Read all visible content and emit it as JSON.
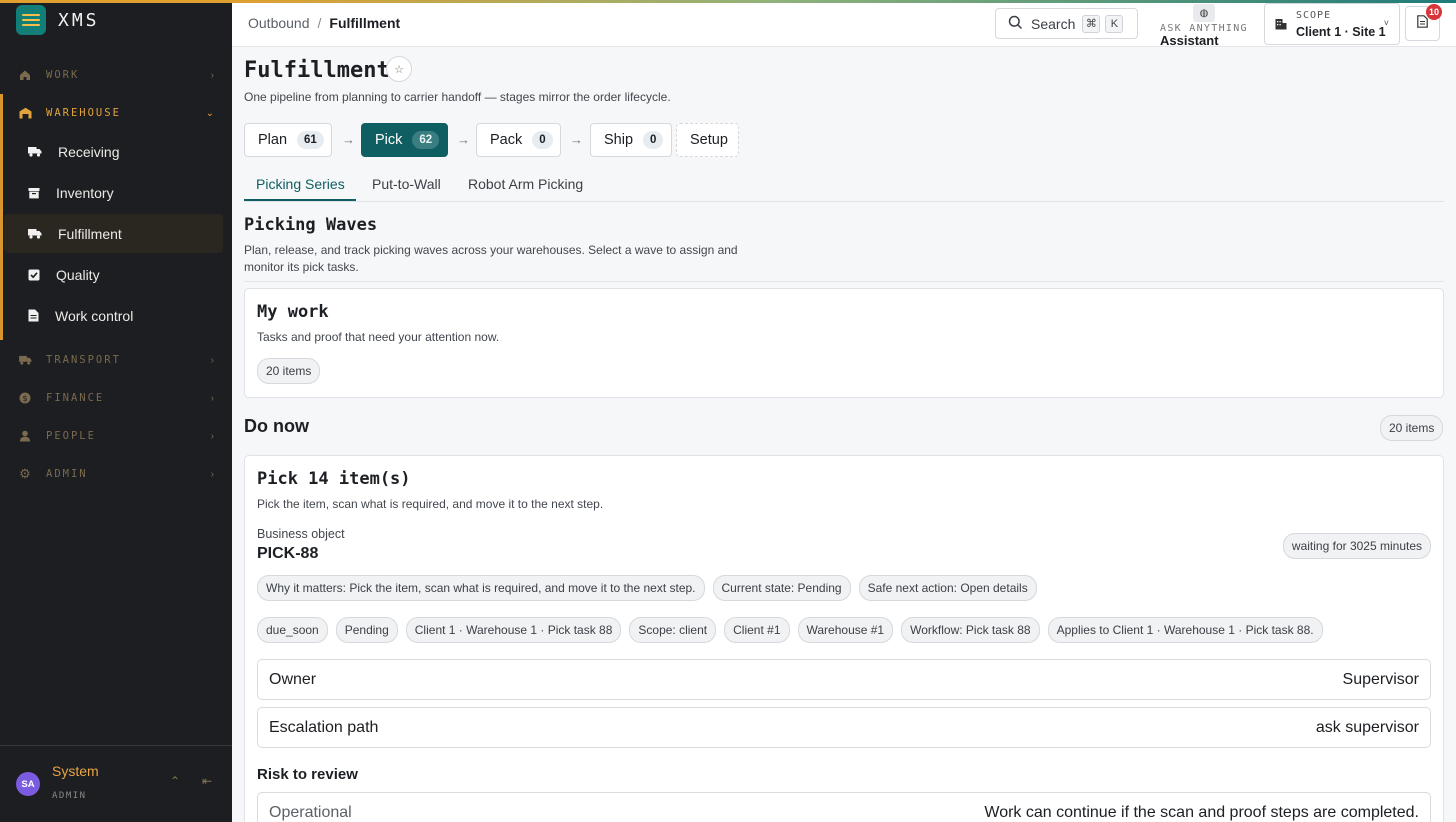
{
  "brand": {
    "name": "XMS"
  },
  "colors": {
    "accent": "#0f5e62",
    "sidebar_active": "#e3a23c",
    "badge": "#d6353a"
  },
  "sidebar": {
    "groups": [
      {
        "label": "WORK",
        "icon": "home-icon"
      },
      {
        "label": "WAREHOUSE",
        "icon": "warehouse-icon"
      },
      {
        "label": "TRANSPORT",
        "icon": "truck-icon"
      },
      {
        "label": "FINANCE",
        "icon": "coin-icon"
      },
      {
        "label": "PEOPLE",
        "icon": "person-icon"
      },
      {
        "label": "ADMIN",
        "icon": "gear-icon"
      }
    ],
    "items": [
      {
        "label": "Receiving",
        "icon": "truck-icon"
      },
      {
        "label": "Inventory",
        "icon": "box-icon"
      },
      {
        "label": "Fulfillment",
        "icon": "truck-icon"
      },
      {
        "label": "Quality",
        "icon": "checkbox-icon"
      },
      {
        "label": "Work control",
        "icon": "document-icon"
      }
    ],
    "user": {
      "initials": "SA",
      "name": "System",
      "role": "ADMIN"
    }
  },
  "header": {
    "breadcrumb": {
      "parent": "Outbound",
      "sep": "/",
      "current": "Fulfillment"
    },
    "search": {
      "label": "Search",
      "key1": "⌘",
      "key2": "K"
    },
    "assistant": {
      "small": "ASK ANYTHING",
      "label": "Assistant"
    },
    "scope": {
      "label": "SCOPE",
      "value": "Client 1 · Site 1"
    },
    "notifications": {
      "count": "10"
    }
  },
  "page": {
    "title": "Fulfillment",
    "subtitle": "One pipeline from planning to carrier handoff — stages mirror the order lifecycle.",
    "stages": [
      {
        "label": "Plan",
        "count": "61"
      },
      {
        "label": "Pick",
        "count": "62"
      },
      {
        "label": "Pack",
        "count": "0"
      },
      {
        "label": "Ship",
        "count": "0"
      },
      {
        "label": "Setup"
      }
    ],
    "tabs": [
      "Picking Series",
      "Put-to-Wall",
      "Robot Arm Picking"
    ],
    "section": {
      "title": "Picking Waves",
      "subtitle": "Plan, release, and track picking waves across your warehouses. Select a wave to assign and monitor its pick tasks."
    },
    "my_work": {
      "title": "My work",
      "subtitle": "Tasks and proof that need your attention now.",
      "count": "20 items"
    },
    "do_now": {
      "title": "Do now",
      "count": "20 items"
    },
    "task": {
      "title": "Pick 14 item(s)",
      "subtitle": "Pick the item, scan what is required, and move it to the next step.",
      "object_label": "Business object",
      "object_id": "PICK-88",
      "waiting": "waiting for 3025 minutes",
      "chips1": [
        "Why it matters: Pick the item, scan what is required, and move it to the next step.",
        "Current state: Pending",
        "Safe next action: Open details"
      ],
      "chips2": [
        "due_soon",
        "Pending",
        "Client 1 · Warehouse 1 · Pick task 88",
        "Scope: client",
        "Client #1",
        "Warehouse #1",
        "Workflow: Pick task 88",
        "Applies to Client 1 · Warehouse 1 · Pick task 88."
      ],
      "owner": {
        "label": "Owner",
        "value": "Supervisor"
      },
      "escalation": {
        "label": "Escalation path",
        "value": "ask supervisor"
      },
      "risk_title": "Risk to review",
      "risk": {
        "label": "Operational",
        "value": "Work can continue if the scan and proof steps are completed."
      }
    }
  }
}
